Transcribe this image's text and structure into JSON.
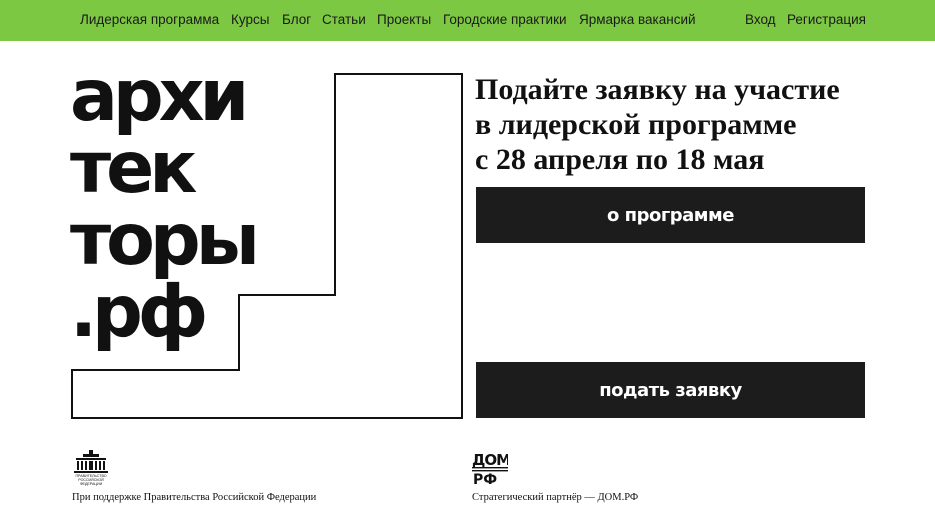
{
  "nav": {
    "items": [
      {
        "label": "Лидерская программа"
      },
      {
        "label": "Курсы"
      },
      {
        "label": "Блог"
      },
      {
        "label": "Статьи"
      },
      {
        "label": "Проекты"
      },
      {
        "label": "Городские практики"
      },
      {
        "label": "Ярмарка вакансий"
      }
    ],
    "login": "Вход",
    "register": "Регистрация"
  },
  "logo": {
    "lines": [
      "архи",
      "тек",
      "торы",
      ".рф"
    ]
  },
  "hero": {
    "headline_lines": [
      "Подайте заявку на участие",
      "в лидерской программе",
      "с 28 апреля по 18 мая"
    ],
    "about_button": "о программе",
    "apply_button": "подать заявку"
  },
  "footer": {
    "gov_emblem_text": "ПРАВИТЕЛЬСТВО РОССИЙСКОЙ ФЕДЕРАЦИИ",
    "gov_caption": "При поддержке Правительства Российской Федерации",
    "partner_caption": "Стратегический партнёр — ДОМ.РФ",
    "partner_logo_text": "ДОМ РФ"
  },
  "colors": {
    "nav_bg": "#7dc843",
    "button_bg": "#1c1c1c"
  }
}
